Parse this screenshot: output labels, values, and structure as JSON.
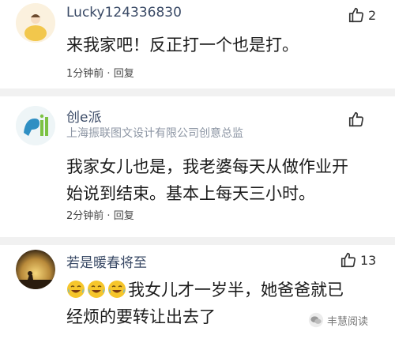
{
  "comments": [
    {
      "name": "Lucky124336830",
      "text": "来我家吧！反正打一个也是打。",
      "time": "1分钟前",
      "reply": "回复",
      "likes": "2"
    },
    {
      "name": "创e派",
      "subtitle": "上海振联图文设计有限公司创意总监",
      "text_line1": "我家女儿也是，我老婆每天从做作业开",
      "text_line2": "始说到结束。基本上每天三小时。",
      "time": "2分钟前",
      "reply": "回复",
      "likes": ""
    },
    {
      "name": "若是暖春将至",
      "text_line1": "我女儿才一岁半，她爸爸就已",
      "text_line2": "经烦的要转让出去了",
      "likes": "13"
    }
  ],
  "watermark": "丰慧阅读",
  "colors": {
    "name": "#3a4a66",
    "meta": "#444444",
    "separator": "#f1f1f1"
  }
}
